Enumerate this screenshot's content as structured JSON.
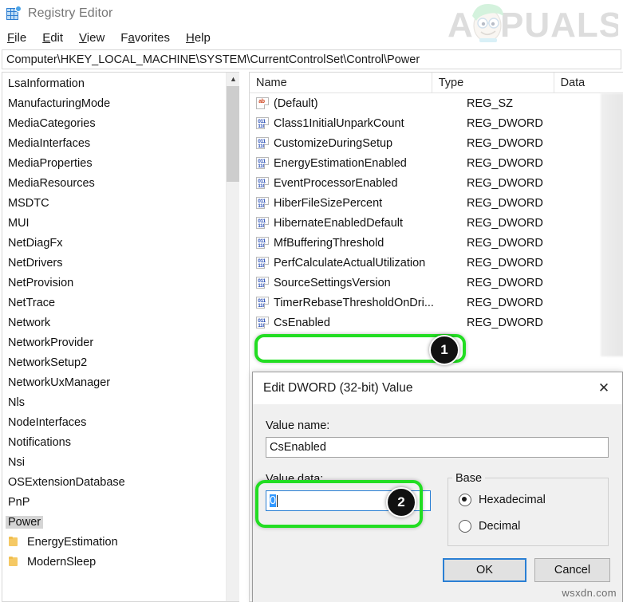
{
  "window": {
    "title": "Registry Editor",
    "icon": "registry-editor-icon"
  },
  "menubar": {
    "items": [
      {
        "label": "File",
        "mnemonic": "F",
        "rest": "ile"
      },
      {
        "label": "Edit",
        "mnemonic": "E",
        "rest": "dit"
      },
      {
        "label": "View",
        "mnemonic": "V",
        "rest": "iew"
      },
      {
        "label": "Favorites",
        "mnemonic": "F",
        "pre": "F",
        "rest": "avorites"
      },
      {
        "label": "Help",
        "mnemonic": "H",
        "rest": "elp"
      }
    ]
  },
  "address": {
    "value": "Computer\\HKEY_LOCAL_MACHINE\\SYSTEM\\CurrentControlSet\\Control\\Power",
    "placeholder": ""
  },
  "tree": {
    "items": [
      {
        "label": "LsaInformation",
        "selected": false,
        "child": false
      },
      {
        "label": "ManufacturingMode",
        "selected": false,
        "child": false
      },
      {
        "label": "MediaCategories",
        "selected": false,
        "child": false
      },
      {
        "label": "MediaInterfaces",
        "selected": false,
        "child": false
      },
      {
        "label": "MediaProperties",
        "selected": false,
        "child": false
      },
      {
        "label": "MediaResources",
        "selected": false,
        "child": false
      },
      {
        "label": "MSDTC",
        "selected": false,
        "child": false
      },
      {
        "label": "MUI",
        "selected": false,
        "child": false
      },
      {
        "label": "NetDiagFx",
        "selected": false,
        "child": false
      },
      {
        "label": "NetDrivers",
        "selected": false,
        "child": false
      },
      {
        "label": "NetProvision",
        "selected": false,
        "child": false
      },
      {
        "label": "NetTrace",
        "selected": false,
        "child": false
      },
      {
        "label": "Network",
        "selected": false,
        "child": false
      },
      {
        "label": "NetworkProvider",
        "selected": false,
        "child": false
      },
      {
        "label": "NetworkSetup2",
        "selected": false,
        "child": false
      },
      {
        "label": "NetworkUxManager",
        "selected": false,
        "child": false
      },
      {
        "label": "Nls",
        "selected": false,
        "child": false
      },
      {
        "label": "NodeInterfaces",
        "selected": false,
        "child": false
      },
      {
        "label": "Notifications",
        "selected": false,
        "child": false
      },
      {
        "label": "Nsi",
        "selected": false,
        "child": false
      },
      {
        "label": "OSExtensionDatabase",
        "selected": false,
        "child": false
      },
      {
        "label": "PnP",
        "selected": false,
        "child": false
      },
      {
        "label": "Power",
        "selected": true,
        "child": false
      },
      {
        "label": "EnergyEstimation",
        "selected": false,
        "child": true
      },
      {
        "label": "ModernSleep",
        "selected": false,
        "child": true
      }
    ]
  },
  "list": {
    "columns": [
      "Name",
      "Type",
      "Data"
    ],
    "rows": [
      {
        "name": "(Default)",
        "type": "REG_SZ",
        "icon": "reg-sz-icon",
        "tag": "ab",
        "data": ""
      },
      {
        "name": "Class1InitialUnparkCount",
        "type": "REG_DWORD",
        "icon": "reg-dword-icon",
        "tag": "011\n110",
        "data": ""
      },
      {
        "name": "CustomizeDuringSetup",
        "type": "REG_DWORD",
        "icon": "reg-dword-icon",
        "tag": "011\n110",
        "data": ""
      },
      {
        "name": "EnergyEstimationEnabled",
        "type": "REG_DWORD",
        "icon": "reg-dword-icon",
        "tag": "011\n110",
        "data": ""
      },
      {
        "name": "EventProcessorEnabled",
        "type": "REG_DWORD",
        "icon": "reg-dword-icon",
        "tag": "011\n110",
        "data": ""
      },
      {
        "name": "HiberFileSizePercent",
        "type": "REG_DWORD",
        "icon": "reg-dword-icon",
        "tag": "011\n110",
        "data": ""
      },
      {
        "name": "HibernateEnabledDefault",
        "type": "REG_DWORD",
        "icon": "reg-dword-icon",
        "tag": "011\n110",
        "data": ""
      },
      {
        "name": "MfBufferingThreshold",
        "type": "REG_DWORD",
        "icon": "reg-dword-icon",
        "tag": "011\n110",
        "data": ""
      },
      {
        "name": "PerfCalculateActualUtilization",
        "type": "REG_DWORD",
        "icon": "reg-dword-icon",
        "tag": "011\n110",
        "data": ""
      },
      {
        "name": "SourceSettingsVersion",
        "type": "REG_DWORD",
        "icon": "reg-dword-icon",
        "tag": "011\n110",
        "data": ""
      },
      {
        "name": "TimerRebaseThresholdOnDri...",
        "type": "REG_DWORD",
        "icon": "reg-dword-icon",
        "tag": "011\n110",
        "data": ""
      },
      {
        "name": "CsEnabled",
        "type": "REG_DWORD",
        "icon": "reg-dword-icon",
        "tag": "011\n110",
        "data": ""
      }
    ]
  },
  "dialog": {
    "title": "Edit DWORD (32-bit) Value",
    "close_label": "✕",
    "value_name_label": "Value name:",
    "value_name": "CsEnabled",
    "value_data_label": "Value data:",
    "value_data": "0",
    "base_legend": "Base",
    "base_options": [
      {
        "label": "Hexadecimal",
        "selected": true
      },
      {
        "label": "Decimal",
        "selected": false
      }
    ],
    "ok_label": "OK",
    "cancel_label": "Cancel"
  },
  "annotations": {
    "steps": [
      {
        "number": "1",
        "target": "CsEnabled"
      },
      {
        "number": "2",
        "target": "Value data"
      }
    ],
    "highlight_color": "#22dd22"
  },
  "watermarks": {
    "brand": "APPUALS",
    "source": "wsxdn.com"
  }
}
